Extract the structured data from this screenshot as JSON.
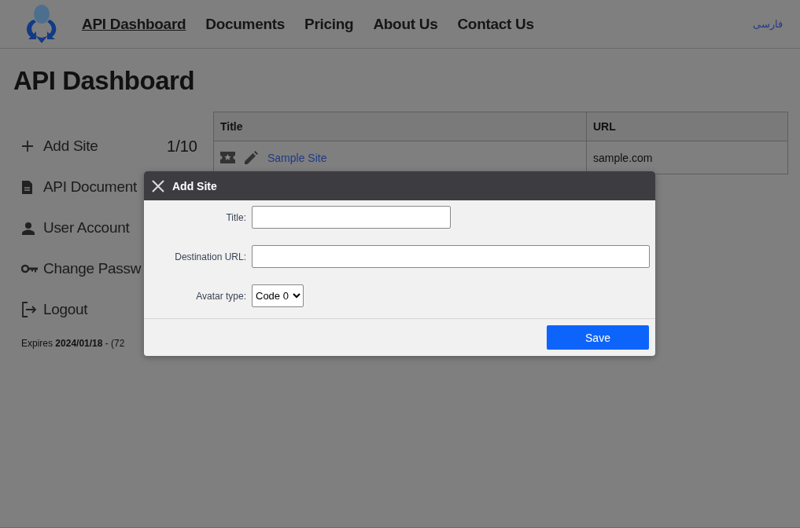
{
  "header": {
    "nav": [
      {
        "label": "API Dashboard",
        "selected": true
      },
      {
        "label": "Documents",
        "selected": false
      },
      {
        "label": "Pricing",
        "selected": false
      },
      {
        "label": "About Us",
        "selected": false
      },
      {
        "label": "Contact Us",
        "selected": false
      }
    ],
    "language_link": "فارسی"
  },
  "page_title": "API Dashboard",
  "sidebar": {
    "items": [
      {
        "kind": "add",
        "label": "Add Site",
        "count": "1/10"
      },
      {
        "kind": "document",
        "label": "API Document"
      },
      {
        "kind": "user",
        "label": "User Account"
      },
      {
        "kind": "key",
        "label": "Change Passw"
      },
      {
        "kind": "logout",
        "label": "Logout"
      }
    ],
    "expiry": "Expires **2024/01/18** - (72"
  },
  "table": {
    "columns": [
      "Title",
      "URL"
    ],
    "rows": [
      {
        "title": "Sample Site",
        "url": "sample.com"
      }
    ]
  },
  "dialog": {
    "title": "Add Site",
    "fields": [
      {
        "kind": "text",
        "label": "Title:"
      },
      {
        "kind": "url",
        "label": "Destination URL:"
      },
      {
        "kind": "select",
        "label": "Avatar type:",
        "value": "Code 0"
      }
    ],
    "save_button": "Save"
  }
}
